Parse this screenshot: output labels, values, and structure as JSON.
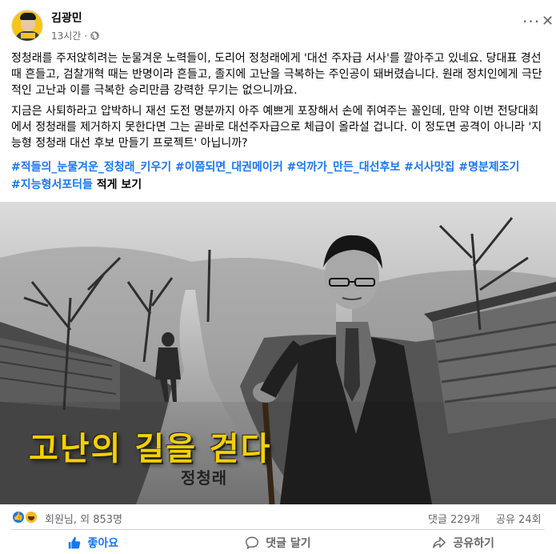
{
  "post": {
    "author": "김광민",
    "time": "13시간",
    "audience_dot": "·",
    "paragraph1": "정청래를 주저앉히려는 눈물겨운 노력들이, 도리어 정청래에게 '대선 주자급 서사'를 깔아주고 있네요. 당대표 경선 때 흔들고, 검찰개혁 때는 반명이라 흔들고, 졸지에 고난을 극복하는 주인공이 돼버렸습니다. 원래 정치인에게 극단적인 고난과 이를 극복한 승리만큼 강력한 무기는 없으니까요.",
    "paragraph2": "지금은 사퇴하라고 압박하니 재선 도전 명분까지 아주 예쁘게 포장해서 손에 쥐여주는 꼴인데, 만약 이번 전당대회에서 정청래를 제거하지 못한다면 그는 곧바로 대선주자급으로 체급이 올라설 겁니다. 이 정도면 공격이 아니라 '지능형 정청래 대선 후보 만들기 프로젝트' 아닙니까?",
    "hashtags": [
      "#적들의_눈물겨운_정청래_키우기",
      "#이쯤되면_대권메이커",
      "#억까가_만든_대선후보",
      "#서사맛집",
      "#명분제조기",
      "#지능형서포터들"
    ],
    "see_more": "적게 보기",
    "more_menu": "···",
    "close": "✕"
  },
  "image": {
    "title": "고난의 길을 걷다",
    "subtitle": "정청래"
  },
  "stats": {
    "reactions": "회원님, 외 853명",
    "comments": "댓글 229개",
    "shares": "공유 24회"
  },
  "actions": {
    "like": "좋아요",
    "comment": "댓글 달기",
    "share": "공유하기"
  },
  "colors": {
    "accent": "#1877f2",
    "secondary_text": "#65676b",
    "caption_yellow": "#f4d000"
  }
}
